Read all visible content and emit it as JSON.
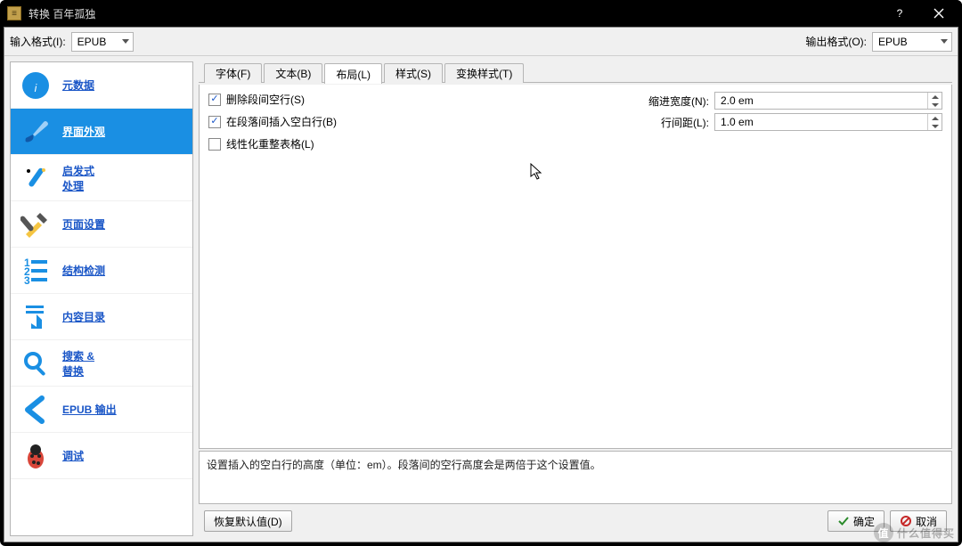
{
  "titlebar": {
    "title": "转换 百年孤独"
  },
  "format": {
    "input_label": "输入格式(I):",
    "input_value": "EPUB",
    "output_label": "输出格式(O):",
    "output_value": "EPUB"
  },
  "sidebar": {
    "items": [
      {
        "label": "元数据"
      },
      {
        "label": "界面外观"
      },
      {
        "label": "启发式\n处理"
      },
      {
        "label": "页面设置"
      },
      {
        "label": "结构检测"
      },
      {
        "label": "内容目录"
      },
      {
        "label": "搜索 &\n替换"
      },
      {
        "label": "EPUB 输出"
      },
      {
        "label": "调试"
      }
    ]
  },
  "tabs": {
    "items": [
      {
        "label": "字体(F)"
      },
      {
        "label": "文本(B)"
      },
      {
        "label": "布局(L)"
      },
      {
        "label": "样式(S)"
      },
      {
        "label": "变换样式(T)"
      }
    ],
    "active": 2
  },
  "layout": {
    "chk_remove_spacing": "删除段间空行(S)",
    "chk_insert_blank": "在段落间插入空白行(B)",
    "chk_linearize": "线性化重整表格(L)",
    "indent_label": "缩进宽度(N):",
    "indent_value": "2.0 em",
    "line_label": "行间距(L):",
    "line_value": "1.0 em"
  },
  "hint": "设置插入的空白行的高度（单位：em）。段落间的空行高度会是两倍于这个设置值。",
  "buttons": {
    "restore": "恢复默认值(D)",
    "ok": "确定",
    "cancel": "取消"
  },
  "watermark": "什么值得买"
}
